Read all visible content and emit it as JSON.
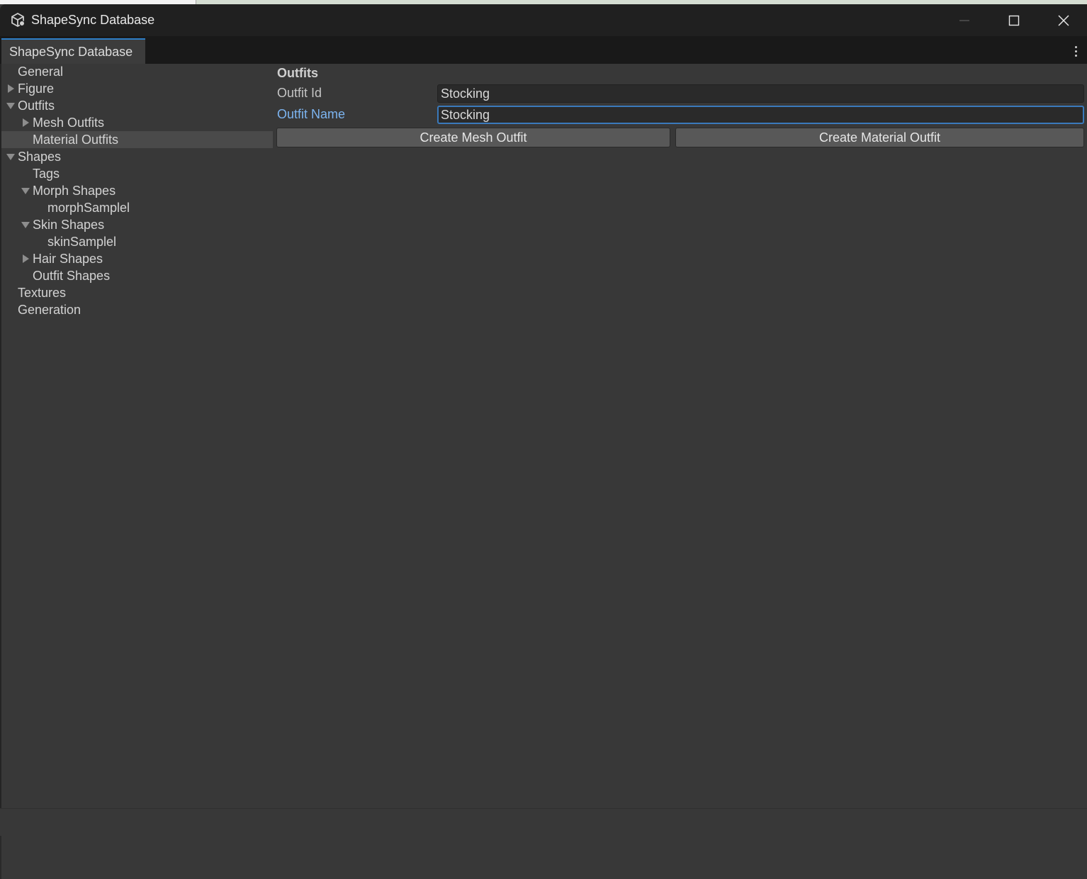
{
  "window": {
    "title": "ShapeSync Database",
    "icon": "unity-cube-icon",
    "controls": [
      "minimize-icon",
      "maximize-icon",
      "close-icon"
    ]
  },
  "tabs": [
    {
      "label": "ShapeSync Database",
      "active": true
    }
  ],
  "tab_menu_icon": "kebab-menu-icon",
  "sidebar": {
    "items": [
      {
        "label": "General",
        "depth": 0,
        "arrow": "none",
        "selected": false
      },
      {
        "label": "Figure",
        "depth": 0,
        "arrow": "collapsed",
        "selected": false
      },
      {
        "label": "Outfits",
        "depth": 0,
        "arrow": "expanded",
        "selected": false
      },
      {
        "label": "Mesh Outfits",
        "depth": 1,
        "arrow": "collapsed",
        "selected": false
      },
      {
        "label": "Material Outfits",
        "depth": 1,
        "arrow": "none",
        "selected": true
      },
      {
        "label": "Shapes",
        "depth": 0,
        "arrow": "expanded",
        "selected": false
      },
      {
        "label": "Tags",
        "depth": 1,
        "arrow": "none",
        "selected": false
      },
      {
        "label": "Morph Shapes",
        "depth": 1,
        "arrow": "expanded",
        "selected": false
      },
      {
        "label": "morphSamplel",
        "depth": 2,
        "arrow": "none",
        "selected": false
      },
      {
        "label": "Skin Shapes",
        "depth": 1,
        "arrow": "expanded",
        "selected": false
      },
      {
        "label": "skinSamplel",
        "depth": 2,
        "arrow": "none",
        "selected": false
      },
      {
        "label": "Hair Shapes",
        "depth": 1,
        "arrow": "collapsed",
        "selected": false
      },
      {
        "label": "Outfit Shapes",
        "depth": 1,
        "arrow": "none",
        "selected": false
      },
      {
        "label": "Textures",
        "depth": 0,
        "arrow": "none",
        "selected": false
      },
      {
        "label": "Generation",
        "depth": 0,
        "arrow": "none",
        "selected": false
      }
    ]
  },
  "main": {
    "section_title": "Outfits",
    "fields": [
      {
        "label": "Outfit Id",
        "value": "Stocking",
        "focused": false
      },
      {
        "label": "Outfit Name",
        "value": "Stocking",
        "focused": true
      }
    ],
    "buttons": {
      "create_mesh": "Create Mesh Outfit",
      "create_material": "Create Material Outfit"
    }
  },
  "colors": {
    "background": "#383838",
    "titlebar": "#202020",
    "tab_accent": "#2d7ec7",
    "focus_label": "#7cb4f0",
    "selected_row": "#4a4a4a"
  }
}
